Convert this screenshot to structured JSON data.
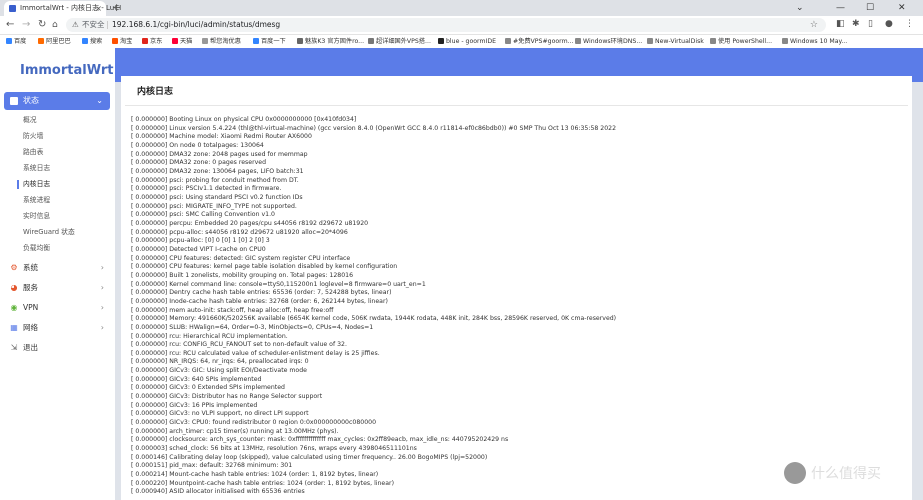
{
  "browser": {
    "tab_title": "ImmortalWrt - 内核日志 - LuCI",
    "tab_close": "×",
    "new_tab": "+",
    "win_min": "—",
    "win_max": "☐",
    "win_close": "✕",
    "win_extra": "⌄",
    "not_secure": "不安全",
    "url": "192.168.6.1/cgi-bin/luci/admin/status/dmesg"
  },
  "bookmarks": [
    {
      "label": "百度",
      "color": "#3385ff"
    },
    {
      "label": "阿里巴巴",
      "color": "#ff6a00"
    },
    {
      "label": "搜索",
      "color": "#3385ff"
    },
    {
      "label": "淘宝",
      "color": "#ff5000"
    },
    {
      "label": "京东",
      "color": "#e1251b"
    },
    {
      "label": "天猫",
      "color": "#ff0036"
    },
    {
      "label": "帮您淘优惠",
      "color": "#999999"
    },
    {
      "label": "百度一下",
      "color": "#3385ff"
    },
    {
      "label": "魅族K3 官方固件ro...",
      "color": "#666666"
    },
    {
      "label": "超详细国外VPS搭...",
      "color": "#777777"
    },
    {
      "label": "blue - goormIDE",
      "color": "#222222"
    },
    {
      "label": "#免费VPS#goorm...",
      "color": "#888888"
    },
    {
      "label": "Windows环境DNS...",
      "color": "#888888"
    },
    {
      "label": "New-VirtualDisk",
      "color": "#888888"
    },
    {
      "label": "使用 PowerShell...",
      "color": "#888888"
    },
    {
      "label": "Windows 10 May...",
      "color": "#888888"
    }
  ],
  "sidebar": {
    "logo": "ImmortalWrt",
    "active_menu": "状态",
    "active_chevron": "⌄",
    "sub_items": [
      {
        "label": "概况",
        "active": false
      },
      {
        "label": "防火墙",
        "active": false
      },
      {
        "label": "路由表",
        "active": false
      },
      {
        "label": "系统日志",
        "active": false
      },
      {
        "label": "内核日志",
        "active": true
      },
      {
        "label": "系统进程",
        "active": false
      },
      {
        "label": "实时信息",
        "active": false
      },
      {
        "label": "WireGuard 状态",
        "active": false
      },
      {
        "label": "负载均衡",
        "active": false
      }
    ],
    "main_items": [
      {
        "label": "系统",
        "icon": "gear-icon",
        "glyph": "⚙",
        "color": "#e4572e",
        "chevron": "›"
      },
      {
        "label": "服务",
        "icon": "services-icon",
        "glyph": "◕",
        "color": "#e4572e",
        "chevron": "›"
      },
      {
        "label": "VPN",
        "icon": "vpn-icon",
        "glyph": "◉",
        "color": "#5fb33a",
        "chevron": "›"
      },
      {
        "label": "网络",
        "icon": "network-icon",
        "glyph": "▦",
        "color": "#5b7ce8",
        "chevron": "›"
      },
      {
        "label": "退出",
        "icon": "logout-icon",
        "glyph": "⇲",
        "color": "#666666",
        "chevron": ""
      }
    ]
  },
  "main": {
    "title": "内核日志"
  },
  "log_lines": [
    "[    0.000000] Booting Linux on physical CPU 0x0000000000 [0x410fd034]",
    "[    0.000000] Linux version 5.4.224 (thl@thl-virtual-machine) (gcc version 8.4.0 (OpenWrt GCC 8.4.0 r11814-ef0c86bdb0)) #0 SMP Thu Oct 13 06:35:58 2022",
    "[    0.000000] Machine model: Xiaomi Redmi Router AX6000",
    "[    0.000000] On node 0 totalpages: 130064",
    "[    0.000000]   DMA32 zone: 2048 pages used for memmap",
    "[    0.000000]   DMA32 zone: 0 pages reserved",
    "[    0.000000]   DMA32 zone: 130064 pages, LIFO batch:31",
    "[    0.000000] psci: probing for conduit method from DT.",
    "[    0.000000] psci: PSCIv1.1 detected in firmware.",
    "[    0.000000] psci: Using standard PSCI v0.2 function IDs",
    "[    0.000000] psci: MIGRATE_INFO_TYPE not supported.",
    "[    0.000000] psci: SMC Calling Convention v1.0",
    "[    0.000000] percpu: Embedded 20 pages/cpu s44056 r8192 d29672 u81920",
    "[    0.000000] pcpu-alloc: s44056 r8192 d29672 u81920 alloc=20*4096",
    "[    0.000000] pcpu-alloc: [0] 0 [0] 1 [0] 2 [0] 3",
    "[    0.000000] Detected VIPT I-cache on CPU0",
    "[    0.000000] CPU features: detected: GIC system register CPU interface",
    "[    0.000000] CPU features: kernel page table isolation disabled by kernel configuration",
    "[    0.000000] Built 1 zonelists, mobility grouping on.  Total pages: 128016",
    "[    0.000000] Kernel command line: console=ttyS0,115200n1 loglevel=8 firmware=0 uart_en=1",
    "[    0.000000] Dentry cache hash table entries: 65536 (order: 7, 524288 bytes, linear)",
    "[    0.000000] Inode-cache hash table entries: 32768 (order: 6, 262144 bytes, linear)",
    "[    0.000000] mem auto-init: stack:off, heap alloc:off, heap free:off",
    "[    0.000000] Memory: 491660K/520256K available (6654K kernel code, 506K rwdata, 1944K rodata, 448K init, 284K bss, 28596K reserved, 0K cma-reserved)",
    "[    0.000000] SLUB: HWalign=64, Order=0-3, MinObjects=0, CPUs=4, Nodes=1",
    "[    0.000000] rcu: Hierarchical RCU implementation.",
    "[    0.000000] rcu:     CONFIG_RCU_FANOUT set to non-default value of 32.",
    "[    0.000000] rcu: RCU calculated value of scheduler-enlistment delay is 25 jiffies.",
    "[    0.000000] NR_IRQS: 64, nr_irqs: 64, preallocated irqs: 0",
    "[    0.000000] GICv3: GIC: Using split EOI/Deactivate mode",
    "[    0.000000] GICv3: 640 SPIs implemented",
    "[    0.000000] GICv3: 0 Extended SPIs implemented",
    "[    0.000000] GICv3: Distributor has no Range Selector support",
    "[    0.000000] GICv3: 16 PPIs implemented",
    "[    0.000000] GICv3: no VLPI support, no direct LPI support",
    "[    0.000000] GICv3: CPU0: found redistributor 0 region 0:0x000000000c080000",
    "[    0.000000] arch_timer: cp15 timer(s) running at 13.00MHz (phys).",
    "[    0.000000] clocksource: arch_sys_counter: mask: 0xffffffffffffff max_cycles: 0x2ff89eacb, max_idle_ns: 440795202429 ns",
    "[    0.000003] sched_clock: 56 bits at 13MHz, resolution 76ns, wraps every 4398046511101ns",
    "[    0.000146] Calibrating delay loop (skipped), value calculated using timer frequency.. 26.00 BogoMIPS (lpj=52000)",
    "[    0.000151] pid_max: default: 32768 minimum: 301",
    "[    0.000214] Mount-cache hash table entries: 1024 (order: 1, 8192 bytes, linear)",
    "[    0.000220] Mountpoint-cache hash table entries: 1024 (order: 1, 8192 bytes, linear)",
    "[    0.000940] ASID allocator initialised with 65536 entries"
  ],
  "watermark": "什么值得买"
}
